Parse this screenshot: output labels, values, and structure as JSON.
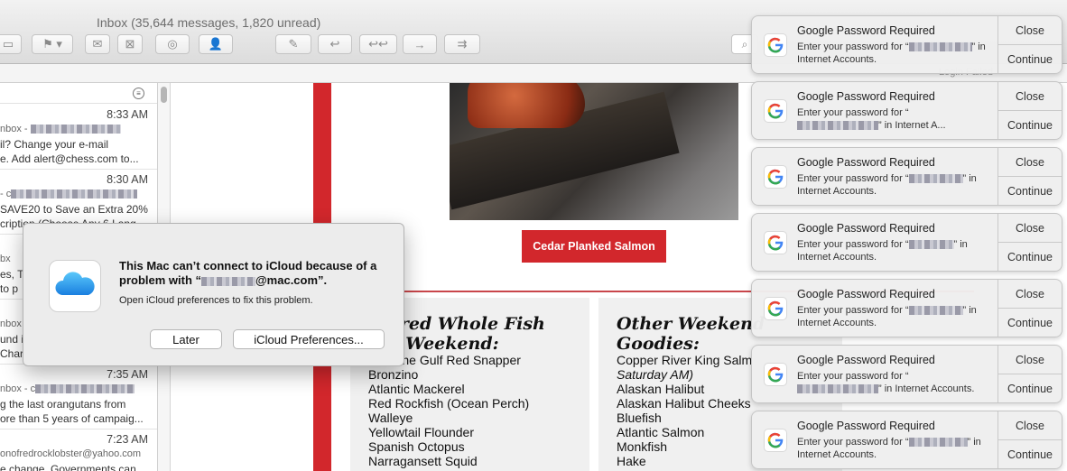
{
  "window": {
    "title": "Inbox (35,644 messages, 1,820 unread)"
  },
  "toolbar": {
    "buttons": [
      "archive",
      "flag-menu",
      "get-mail",
      "junk",
      "reply-tracking",
      "add-contact",
      "compose",
      "reply",
      "reply-all",
      "forward",
      "redirect"
    ]
  },
  "status": {
    "login_failed": "Login Failed"
  },
  "message_list": {
    "messages": [
      {
        "time": "8:33 AM",
        "line1": "nbox - ",
        "line2": "il? Change your e-mail",
        "line3": "e. Add alert@chess.com to..."
      },
      {
        "time": "8:30 AM",
        "line1": " - c",
        "line2": "SAVE20 to Save an Extra 20%",
        "line3": "cription (Choose Any 6 Lang..."
      },
      {
        "time": "",
        "line1": "bx",
        "line2": "es, T",
        "line3": "to p"
      },
      {
        "time": "",
        "line1": "nbox",
        "line2": "und i",
        "line3": "Char"
      },
      {
        "time": "7:35 AM",
        "line1": "nbox - c",
        "line2": "g the last orangutans from",
        "line3": "ore than 5 years of campaig..."
      },
      {
        "time": "7:23 AM",
        "line1": "onofredrocklobster@yahoo.com",
        "line2": "e change. Governments can",
        "line3": ""
      }
    ]
  },
  "email": {
    "caption": "Cedar Planked Salmon",
    "col1": {
      "heading": "atured Whole Fish\nthe Weekend:",
      "items": [
        "Genuine Gulf Red Snapper",
        "Bronzino",
        "Atlantic Mackerel",
        "Red Rockfish (Ocean Perch)",
        "Walleye",
        "Yellowtail Flounder",
        "Spanish Octopus",
        "Narragansett Squid"
      ]
    },
    "col2": {
      "heading": "Other Weekend\nGoodies:",
      "items": [
        "Copper River King Salm",
        "Saturday AM)",
        "Alaskan Halibut",
        "Alaskan Halibut Cheeks",
        "Bluefish",
        "Atlantic Salmon",
        "Monkfish",
        "Hake"
      ]
    },
    "accent_color": "#d2272c"
  },
  "dialog": {
    "title_a": "This Mac can’t connect to iCloud because of a problem with “",
    "title_b": "@mac.com”.",
    "message": "Open iCloud preferences to fix this problem.",
    "later": "Later",
    "preferences": "iCloud Preferences..."
  },
  "notifications": [
    {
      "title": "Google Password Required",
      "pre": "Enter your password for “",
      "post": "” in Internet Accounts.",
      "close": "Close",
      "continue": "Continue"
    },
    {
      "title": "Google Password Required",
      "pre": "Enter your password for “",
      "post": "” in Internet A...",
      "close": "Close",
      "continue": "Continue"
    },
    {
      "title": "Google Password Required",
      "pre": "Enter your password for “",
      "post": "” in Internet Accounts.",
      "close": "Close",
      "continue": "Continue"
    },
    {
      "title": "Google Password Required",
      "pre": "Enter your password for “",
      "post": "” in Internet Accounts.",
      "close": "Close",
      "continue": "Continue"
    },
    {
      "title": "Google Password Required",
      "pre": "Enter your password for “",
      "post": "” in Internet Accounts.",
      "close": "Close",
      "continue": "Continue"
    },
    {
      "title": "Google Password Required",
      "pre": "Enter your password for “",
      "post": "” in Internet Accounts.",
      "close": "Close",
      "continue": "Continue"
    },
    {
      "title": "Google Password Required",
      "pre": "Enter your password for “",
      "post": "” in Internet Accounts.",
      "close": "Close",
      "continue": "Continue"
    }
  ]
}
